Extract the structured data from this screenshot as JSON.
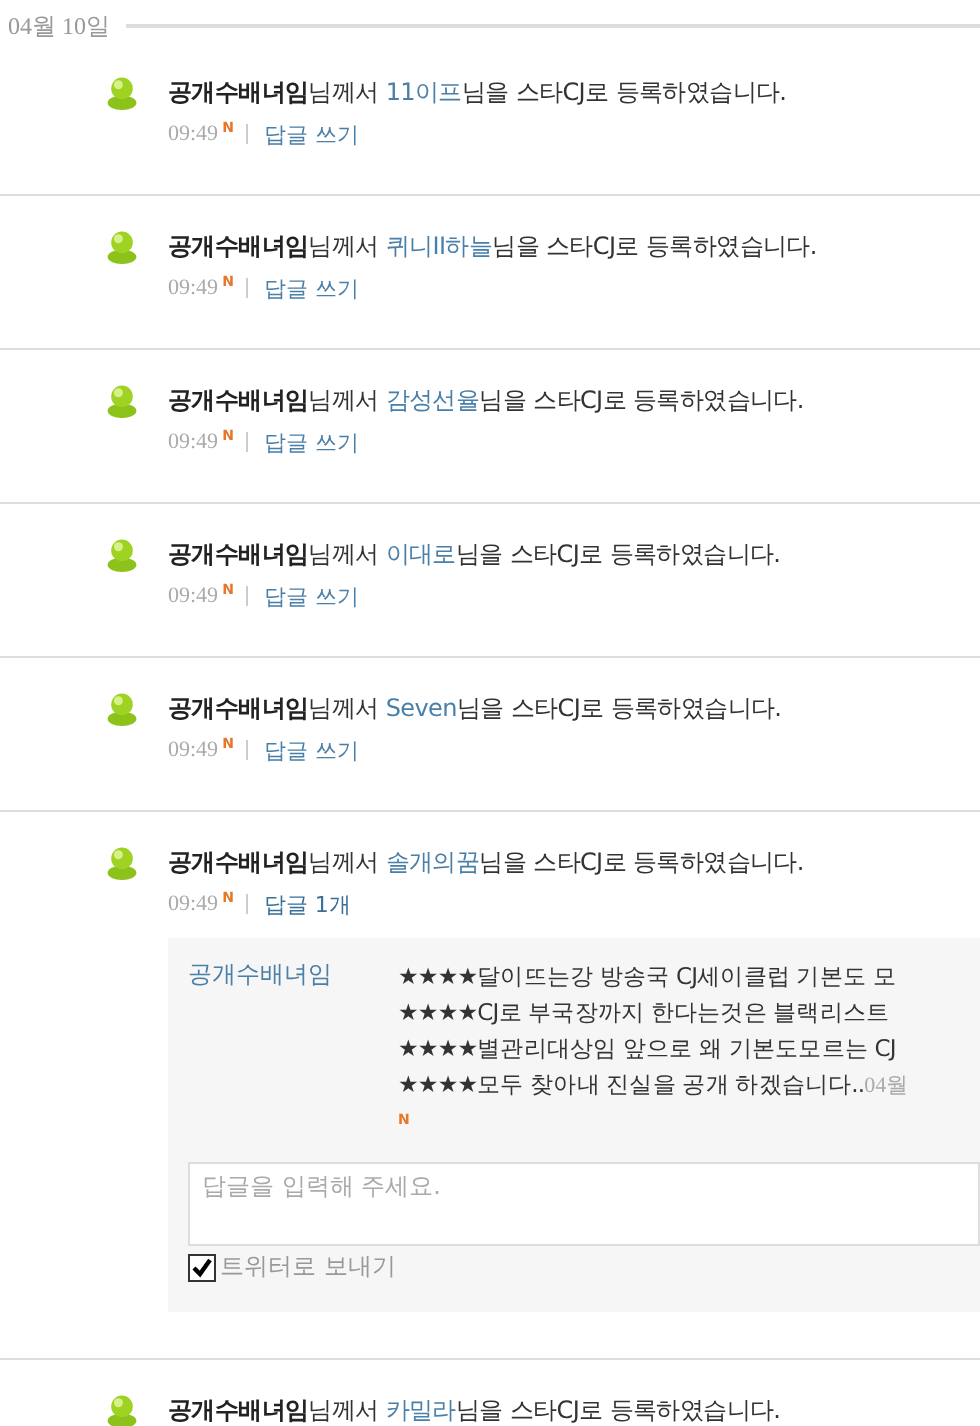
{
  "date_header": "04월 10일",
  "entries": [
    {
      "user": "공개수배녀임",
      "text_1": "님께서 ",
      "star": "11이프",
      "text_2": "님을 스타CJ로 등록하였습니다.",
      "time": "09:49",
      "new_mark": "N",
      "action": "답글 쓰기",
      "expanded": false
    },
    {
      "user": "공개수배녀임",
      "text_1": "님께서 ",
      "star": "퀴니II하늘",
      "text_2": "님을 스타CJ로 등록하였습니다.",
      "time": "09:49",
      "new_mark": "N",
      "action": "답글 쓰기",
      "expanded": false
    },
    {
      "user": "공개수배녀임",
      "text_1": "님께서 ",
      "star": "감성선율",
      "text_2": "님을 스타CJ로 등록하였습니다.",
      "time": "09:49",
      "new_mark": "N",
      "action": "답글 쓰기",
      "expanded": false
    },
    {
      "user": "공개수배녀임",
      "text_1": "님께서 ",
      "star": "이대로",
      "text_2": "님을 스타CJ로 등록하였습니다.",
      "time": "09:49",
      "new_mark": "N",
      "action": "답글 쓰기",
      "expanded": false
    },
    {
      "user": "공개수배녀임",
      "text_1": "님께서 ",
      "star": "Seven",
      "text_2": "님을 스타CJ로 등록하였습니다.",
      "time": "09:49",
      "new_mark": "N",
      "action": "답글 쓰기",
      "expanded": false
    },
    {
      "user": "공개수배녀임",
      "text_1": "님께서 ",
      "star": "솔개의꿈",
      "text_2": "님을 스타CJ로 등록하였습니다.",
      "time": "09:49",
      "new_mark": "N",
      "action": "답글 1개",
      "expanded": true,
      "replies": [
        {
          "author": "공개수배녀임",
          "lines": [
            "★★★★달이뜨는강 방송국 CJ세이클럽 기본도 모",
            "★★★★CJ로 부국장까지 한다는것은 블랙리스트",
            "★★★★별관리대상임 앞으로 왜 기본도모르는 CJ",
            "★★★★모두 찾아내 진실을 공개 하겠습니다.."
          ],
          "date": "04월",
          "new_mark": "N"
        }
      ],
      "reply_form": {
        "placeholder": "답글을 입력해 주세요.",
        "twitter_label": "트위터로 보내기",
        "twitter_checked": true
      }
    },
    {
      "user": "공개수배녀임",
      "text_1": "님께서 ",
      "star": "카밀라",
      "text_2": "님을 스타CJ로 등록하였습니다."
    }
  ]
}
